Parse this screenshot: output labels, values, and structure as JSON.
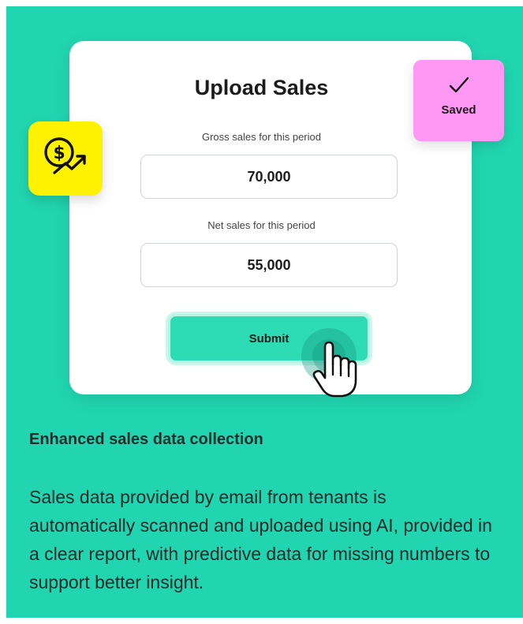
{
  "card": {
    "title": "Upload Sales",
    "gross": {
      "label": "Gross sales for this period",
      "value": "70,000"
    },
    "net": {
      "label": "Net sales for this period",
      "value": "55,000"
    },
    "submit_label": "Submit"
  },
  "badges": {
    "saved_label": "Saved",
    "saved_icon": "checkmark-icon",
    "money_icon": "dollar-trend-up-icon"
  },
  "colors": {
    "background": "#21d5b0",
    "money_badge": "#fff200",
    "saved_badge": "#ff97f5",
    "submit": "#2ddbb4"
  },
  "content": {
    "heading": "Enhanced sales data collection",
    "body": "Sales data provided by email from tenants is automatically scanned and uploaded using AI, provided in a clear report, with predictive data for missing numbers to support better insight."
  }
}
